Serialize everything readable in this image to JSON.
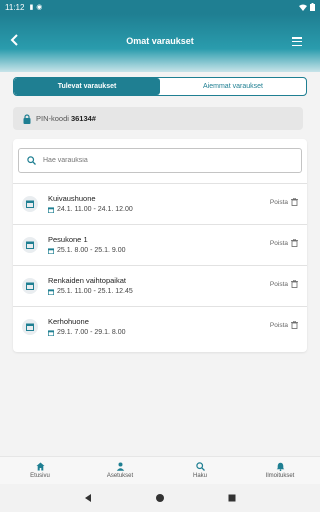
{
  "statusbar": {
    "time": "11:12"
  },
  "appbar": {
    "title": "Omat varaukset"
  },
  "tabs": {
    "upcoming": "Tulevat varaukset",
    "past": "Aiemmat varaukset"
  },
  "pin": {
    "label": "PIN-koodi",
    "value": "36134#"
  },
  "search": {
    "placeholder": "Hae varauksia"
  },
  "delete_label": "Poista",
  "reservations": [
    {
      "name": "Kuivaushuone",
      "time": "24.1. 11.00 - 24.1. 12.00"
    },
    {
      "name": "Pesukone 1",
      "time": "25.1. 8.00 - 25.1. 9.00"
    },
    {
      "name": "Renkaiden vaihtopaikat",
      "time": "25.1. 11.00 - 25.1. 12.45"
    },
    {
      "name": "Kerhohuone",
      "time": "29.1. 7.00 - 29.1. 8.00"
    }
  ],
  "bottomnav": [
    {
      "label": "Etusivu",
      "icon": "home-icon"
    },
    {
      "label": "Asetukset",
      "icon": "person-icon"
    },
    {
      "label": "Haku",
      "icon": "search-icon"
    },
    {
      "label": "Ilmoitukset",
      "icon": "bell-icon"
    }
  ],
  "colors": {
    "primary": "#1f7f92",
    "background": "#f3f3f3"
  }
}
